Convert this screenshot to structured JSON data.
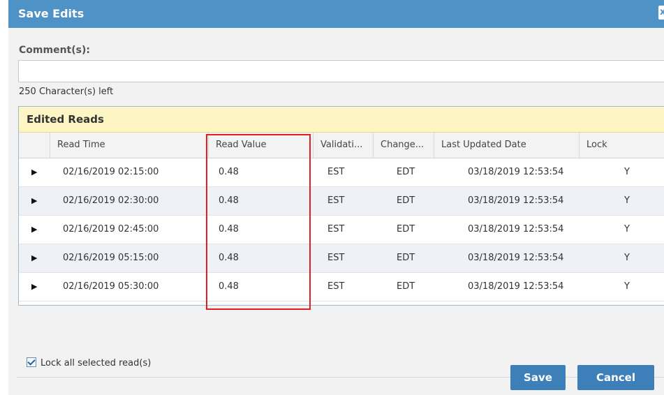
{
  "dialog": {
    "title": "Save Edits"
  },
  "comment": {
    "label": "Comment(s):",
    "value": "",
    "chars_left": "250 Character(s) left"
  },
  "grid": {
    "title": "Edited Reads",
    "columns": [
      "Read Time",
      "Read Value",
      "Validati...",
      "Change...",
      "Last Updated Date",
      "Lock"
    ],
    "rows": [
      {
        "read_time": "02/16/2019 02:15:00",
        "read_value": "0.48",
        "validation": "EST",
        "change": "EDT",
        "last_updated": "03/18/2019 12:53:54",
        "lock": "Y"
      },
      {
        "read_time": "02/16/2019 02:30:00",
        "read_value": "0.48",
        "validation": "EST",
        "change": "EDT",
        "last_updated": "03/18/2019 12:53:54",
        "lock": "Y"
      },
      {
        "read_time": "02/16/2019 02:45:00",
        "read_value": "0.48",
        "validation": "EST",
        "change": "EDT",
        "last_updated": "03/18/2019 12:53:54",
        "lock": "Y"
      },
      {
        "read_time": "02/16/2019 05:15:00",
        "read_value": "0.48",
        "validation": "EST",
        "change": "EDT",
        "last_updated": "03/18/2019 12:53:54",
        "lock": "Y"
      },
      {
        "read_time": "02/16/2019 05:30:00",
        "read_value": "0.48",
        "validation": "EST",
        "change": "EDT",
        "last_updated": "03/18/2019 12:53:54",
        "lock": "Y"
      }
    ]
  },
  "lock_all": {
    "label": "Lock all selected read(s)",
    "checked": true
  },
  "buttons": {
    "save": "Save",
    "cancel": "Cancel"
  },
  "icons": {
    "close": "close-icon",
    "expand": "expand-row-icon",
    "check": "checkbox-checked-icon"
  },
  "colors": {
    "title_bar": "#4f93c6",
    "grid_header": "#fdf5c3",
    "highlight": "#e02020",
    "button": "#3d7fb8"
  }
}
